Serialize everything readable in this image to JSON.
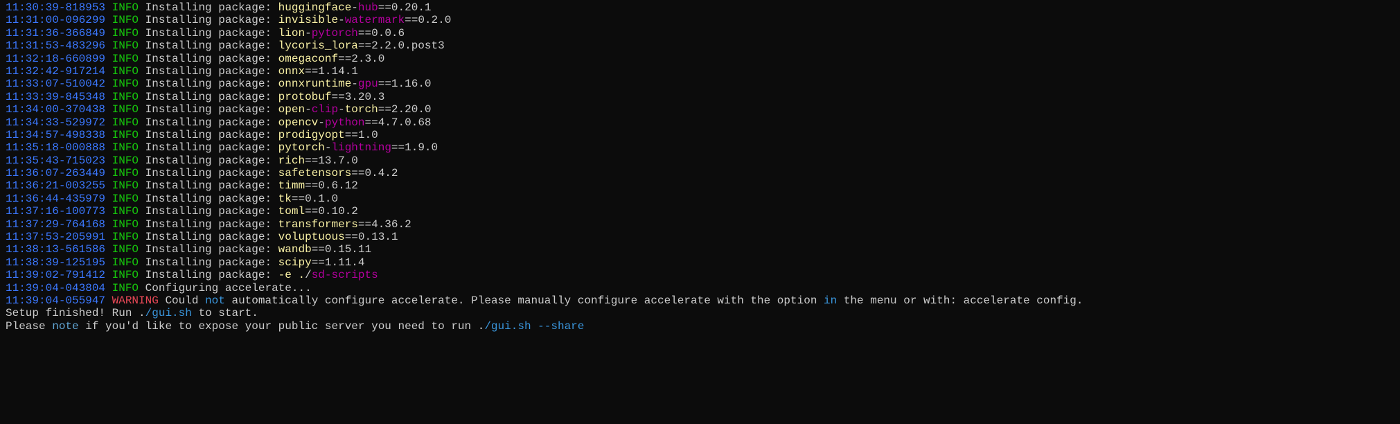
{
  "lines": [
    {
      "ts": "11:30:39-818953",
      "level": "INFO",
      "prefix": "    Installing package: ",
      "pkg_parts": [
        {
          "t": "huggingface",
          "c": "pkg-yellow"
        },
        {
          "t": "-",
          "c": "white"
        },
        {
          "t": "hub",
          "c": "pkg-magenta"
        }
      ],
      "ver": "==0.20.1"
    },
    {
      "ts": "11:31:00-096299",
      "level": "INFO",
      "prefix": "    Installing package: ",
      "pkg_parts": [
        {
          "t": "invisible",
          "c": "pkg-yellow"
        },
        {
          "t": "-",
          "c": "white"
        },
        {
          "t": "watermark",
          "c": "pkg-magenta"
        }
      ],
      "ver": "==0.2.0"
    },
    {
      "ts": "11:31:36-366849",
      "level": "INFO",
      "prefix": "    Installing package: ",
      "pkg_parts": [
        {
          "t": "lion",
          "c": "pkg-yellow"
        },
        {
          "t": "-",
          "c": "white"
        },
        {
          "t": "pytorch",
          "c": "pkg-magenta"
        }
      ],
      "ver": "==0.0.6"
    },
    {
      "ts": "11:31:53-483296",
      "level": "INFO",
      "prefix": "    Installing package: ",
      "pkg_parts": [
        {
          "t": "lycoris_lora",
          "c": "pkg-yellow"
        }
      ],
      "ver": "==2.2.0.post3"
    },
    {
      "ts": "11:32:18-660899",
      "level": "INFO",
      "prefix": "    Installing package: ",
      "pkg_parts": [
        {
          "t": "omegaconf",
          "c": "pkg-yellow"
        }
      ],
      "ver": "==2.3.0"
    },
    {
      "ts": "11:32:42-917214",
      "level": "INFO",
      "prefix": "    Installing package: ",
      "pkg_parts": [
        {
          "t": "onnx",
          "c": "pkg-yellow"
        }
      ],
      "ver": "==1.14.1"
    },
    {
      "ts": "11:33:07-510042",
      "level": "INFO",
      "prefix": "    Installing package: ",
      "pkg_parts": [
        {
          "t": "onnxruntime",
          "c": "pkg-yellow"
        },
        {
          "t": "-",
          "c": "white"
        },
        {
          "t": "gpu",
          "c": "pkg-magenta"
        }
      ],
      "ver": "==1.16.0"
    },
    {
      "ts": "11:33:39-845348",
      "level": "INFO",
      "prefix": "    Installing package: ",
      "pkg_parts": [
        {
          "t": "protobuf",
          "c": "pkg-yellow"
        }
      ],
      "ver": "==3.20.3"
    },
    {
      "ts": "11:34:00-370438",
      "level": "INFO",
      "prefix": "    Installing package: ",
      "pkg_parts": [
        {
          "t": "open",
          "c": "pkg-yellow"
        },
        {
          "t": "-",
          "c": "white"
        },
        {
          "t": "clip",
          "c": "pkg-magenta"
        },
        {
          "t": "-",
          "c": "white"
        },
        {
          "t": "torch",
          "c": "pkg-yellow"
        }
      ],
      "ver": "==2.20.0"
    },
    {
      "ts": "11:34:33-529972",
      "level": "INFO",
      "prefix": "    Installing package: ",
      "pkg_parts": [
        {
          "t": "opencv",
          "c": "pkg-yellow"
        },
        {
          "t": "-",
          "c": "white"
        },
        {
          "t": "python",
          "c": "pkg-magenta"
        }
      ],
      "ver": "==4.7.0.68"
    },
    {
      "ts": "11:34:57-498338",
      "level": "INFO",
      "prefix": "    Installing package: ",
      "pkg_parts": [
        {
          "t": "prodigyopt",
          "c": "pkg-yellow"
        }
      ],
      "ver": "==1.0"
    },
    {
      "ts": "11:35:18-000888",
      "level": "INFO",
      "prefix": "    Installing package: ",
      "pkg_parts": [
        {
          "t": "pytorch",
          "c": "pkg-yellow"
        },
        {
          "t": "-",
          "c": "white"
        },
        {
          "t": "lightning",
          "c": "pkg-magenta"
        }
      ],
      "ver": "==1.9.0"
    },
    {
      "ts": "11:35:43-715023",
      "level": "INFO",
      "prefix": "    Installing package: ",
      "pkg_parts": [
        {
          "t": "rich",
          "c": "pkg-yellow"
        }
      ],
      "ver": "==13.7.0"
    },
    {
      "ts": "11:36:07-263449",
      "level": "INFO",
      "prefix": "    Installing package: ",
      "pkg_parts": [
        {
          "t": "safetensors",
          "c": "pkg-yellow"
        }
      ],
      "ver": "==0.4.2"
    },
    {
      "ts": "11:36:21-003255",
      "level": "INFO",
      "prefix": "    Installing package: ",
      "pkg_parts": [
        {
          "t": "timm",
          "c": "pkg-yellow"
        }
      ],
      "ver": "==0.6.12"
    },
    {
      "ts": "11:36:44-435979",
      "level": "INFO",
      "prefix": "    Installing package: ",
      "pkg_parts": [
        {
          "t": "tk",
          "c": "pkg-yellow"
        }
      ],
      "ver": "==0.1.0"
    },
    {
      "ts": "11:37:16-100773",
      "level": "INFO",
      "prefix": "    Installing package: ",
      "pkg_parts": [
        {
          "t": "toml",
          "c": "pkg-yellow"
        }
      ],
      "ver": "==0.10.2"
    },
    {
      "ts": "11:37:29-764168",
      "level": "INFO",
      "prefix": "    Installing package: ",
      "pkg_parts": [
        {
          "t": "transformers",
          "c": "pkg-yellow"
        }
      ],
      "ver": "==4.36.2"
    },
    {
      "ts": "11:37:53-205991",
      "level": "INFO",
      "prefix": "    Installing package: ",
      "pkg_parts": [
        {
          "t": "voluptuous",
          "c": "pkg-yellow"
        }
      ],
      "ver": "==0.13.1"
    },
    {
      "ts": "11:38:13-561586",
      "level": "INFO",
      "prefix": "    Installing package: ",
      "pkg_parts": [
        {
          "t": "wandb",
          "c": "pkg-yellow"
        }
      ],
      "ver": "==0.15.11"
    },
    {
      "ts": "11:38:39-125195",
      "level": "INFO",
      "prefix": "    Installing package: ",
      "pkg_parts": [
        {
          "t": "scipy",
          "c": "pkg-yellow"
        }
      ],
      "ver": "==1.11.4"
    },
    {
      "ts": "11:39:02-791412",
      "level": "INFO",
      "prefix": "    Installing package: ",
      "pkg_parts": [
        {
          "t": "-e .",
          "c": "pkg-yellow"
        },
        {
          "t": "/",
          "c": "white"
        },
        {
          "t": "sd-scripts",
          "c": "pkg-magenta"
        }
      ],
      "ver": ""
    },
    {
      "ts": "11:39:04-043804",
      "level": "INFO",
      "prefix": "    Configuring accelerate...",
      "pkg_parts": [],
      "ver": ""
    }
  ],
  "warning": {
    "ts": "11:39:04-055947",
    "level": "WARNING",
    "msg_parts": [
      {
        "t": "  Could ",
        "c": "white"
      },
      {
        "t": "not",
        "c": "special"
      },
      {
        "t": " automatically configure accelerate. Please manually configure accelerate with the option ",
        "c": "white"
      },
      {
        "t": "in",
        "c": "special"
      },
      {
        "t": " the menu or with: accelerate config.",
        "c": "white"
      }
    ]
  },
  "setup_finished": {
    "parts": [
      {
        "t": "Setup finished! Run .",
        "c": "white"
      },
      {
        "t": "/gui.sh",
        "c": "special"
      },
      {
        "t": " to start.",
        "c": "white"
      }
    ]
  },
  "please_note": {
    "parts": [
      {
        "t": "Please ",
        "c": "white"
      },
      {
        "t": "note",
        "c": "note"
      },
      {
        "t": " if you'd ",
        "c": "white"
      },
      {
        "t": "like",
        "c": "white"
      },
      {
        "t": " to expose your public server you need to run .",
        "c": "white"
      },
      {
        "t": "/gui.sh",
        "c": "special"
      },
      {
        "t": " ",
        "c": "white"
      },
      {
        "t": "--share",
        "c": "share"
      }
    ]
  }
}
